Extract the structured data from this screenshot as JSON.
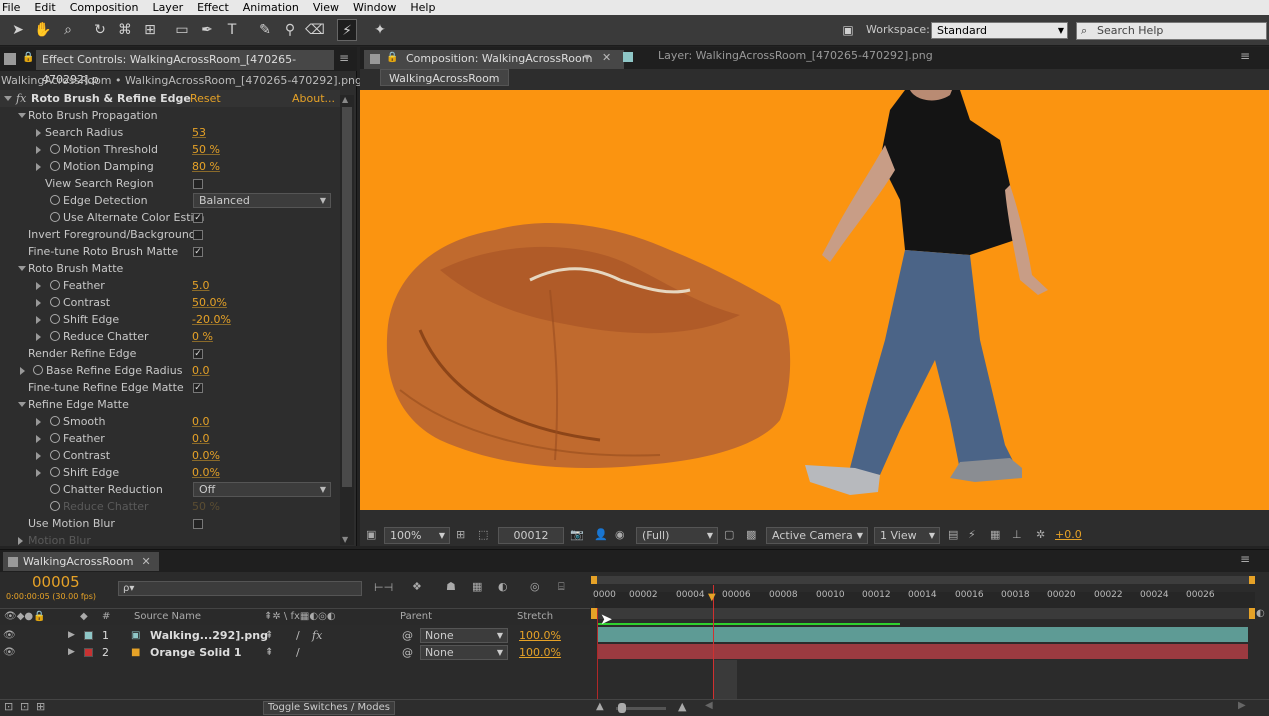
{
  "menu": [
    "File",
    "Edit",
    "Composition",
    "Layer",
    "Effect",
    "Animation",
    "View",
    "Window",
    "Help"
  ],
  "toolbar": {
    "workspace_label": "Workspace:",
    "workspace_value": "Standard",
    "search_placeholder": "Search Help"
  },
  "effect_controls": {
    "tab_title": "Effect Controls: WalkingAcrossRoom_[470265-470292].p",
    "breadcrumb": "WalkingAcrossRoom • WalkingAcrossRoom_[470265-470292].png",
    "effect_name": "Roto Brush & Refine Edge",
    "reset": "Reset",
    "about": "About...",
    "rows": [
      {
        "label": "Roto Brush Propagation",
        "kind": "group"
      },
      {
        "label": "Search Radius",
        "value": "53"
      },
      {
        "label": "Motion Threshold",
        "value": "50 %"
      },
      {
        "label": "Motion Damping",
        "value": "80 %"
      },
      {
        "label": "View Search Region",
        "check": ""
      },
      {
        "label": "Edge Detection",
        "select": "Balanced"
      },
      {
        "label": "Use Alternate Color Estim",
        "check": "✓"
      },
      {
        "label": "Invert Foreground/Background",
        "check": ""
      },
      {
        "label": "Fine-tune Roto Brush Matte",
        "check": "✓"
      },
      {
        "label": "Roto Brush Matte",
        "kind": "group"
      },
      {
        "label": "Feather",
        "value": "5.0"
      },
      {
        "label": "Contrast",
        "value": "50.0%"
      },
      {
        "label": "Shift Edge",
        "value": "-20.0%"
      },
      {
        "label": "Reduce Chatter",
        "value": "0 %"
      },
      {
        "label": "Render Refine Edge",
        "check": "✓"
      },
      {
        "label": "Base Refine Edge Radius",
        "value": "0.0"
      },
      {
        "label": "Fine-tune Refine Edge Matte",
        "check": "✓"
      },
      {
        "label": "Refine Edge Matte",
        "kind": "group"
      },
      {
        "label": "Smooth",
        "value": "0.0"
      },
      {
        "label": "Feather",
        "value": "0.0"
      },
      {
        "label": "Contrast",
        "value": "0.0%"
      },
      {
        "label": "Shift Edge",
        "value": "0.0%"
      },
      {
        "label": "Chatter Reduction",
        "select": "Off"
      },
      {
        "label": "Reduce Chatter",
        "value": "50 %",
        "dim": true
      },
      {
        "label": "Use Motion Blur",
        "check": ""
      },
      {
        "label": "Motion Blur",
        "dim": true
      }
    ]
  },
  "composition": {
    "tab_title": "Composition: WalkingAcrossRoom",
    "layer_tab": "Layer: WalkingAcrossRoom_[470265-470292].png",
    "comp_chip": "WalkingAcrossRoom",
    "zoom": "100%",
    "timecode": "00012",
    "resolution": "(Full)",
    "camera": "Active Camera",
    "views": "1 View",
    "exposure": "+0.0",
    "bg_color": "#fb9410"
  },
  "timeline": {
    "tab_title": "WalkingAcrossRoom",
    "current_frame": "00005",
    "timecode_sub": "0:00:00:05 (30.00 fps)",
    "search_placeholder": "ρ▾",
    "columns": {
      "num": "#",
      "source": "Source Name",
      "parent": "Parent",
      "stretch": "Stretch"
    },
    "ruler_labels": [
      "0000",
      "00002",
      "00004",
      "00006",
      "00008",
      "00010",
      "00012",
      "00014",
      "00016",
      "00018",
      "00020",
      "00022",
      "00024",
      "00026"
    ],
    "layers": [
      {
        "num": "1",
        "name": "Walking...292].png",
        "parent": "None",
        "stretch": "100.0%",
        "label_color": "#8fc7c7",
        "bar_color": "#5e9b95"
      },
      {
        "num": "2",
        "name": "Orange Solid 1",
        "parent": "None",
        "stretch": "100.0%",
        "label_color": "#c83232",
        "bar_color": "#9b3a40"
      }
    ],
    "toggle_label": "Toggle Switches / Modes"
  }
}
